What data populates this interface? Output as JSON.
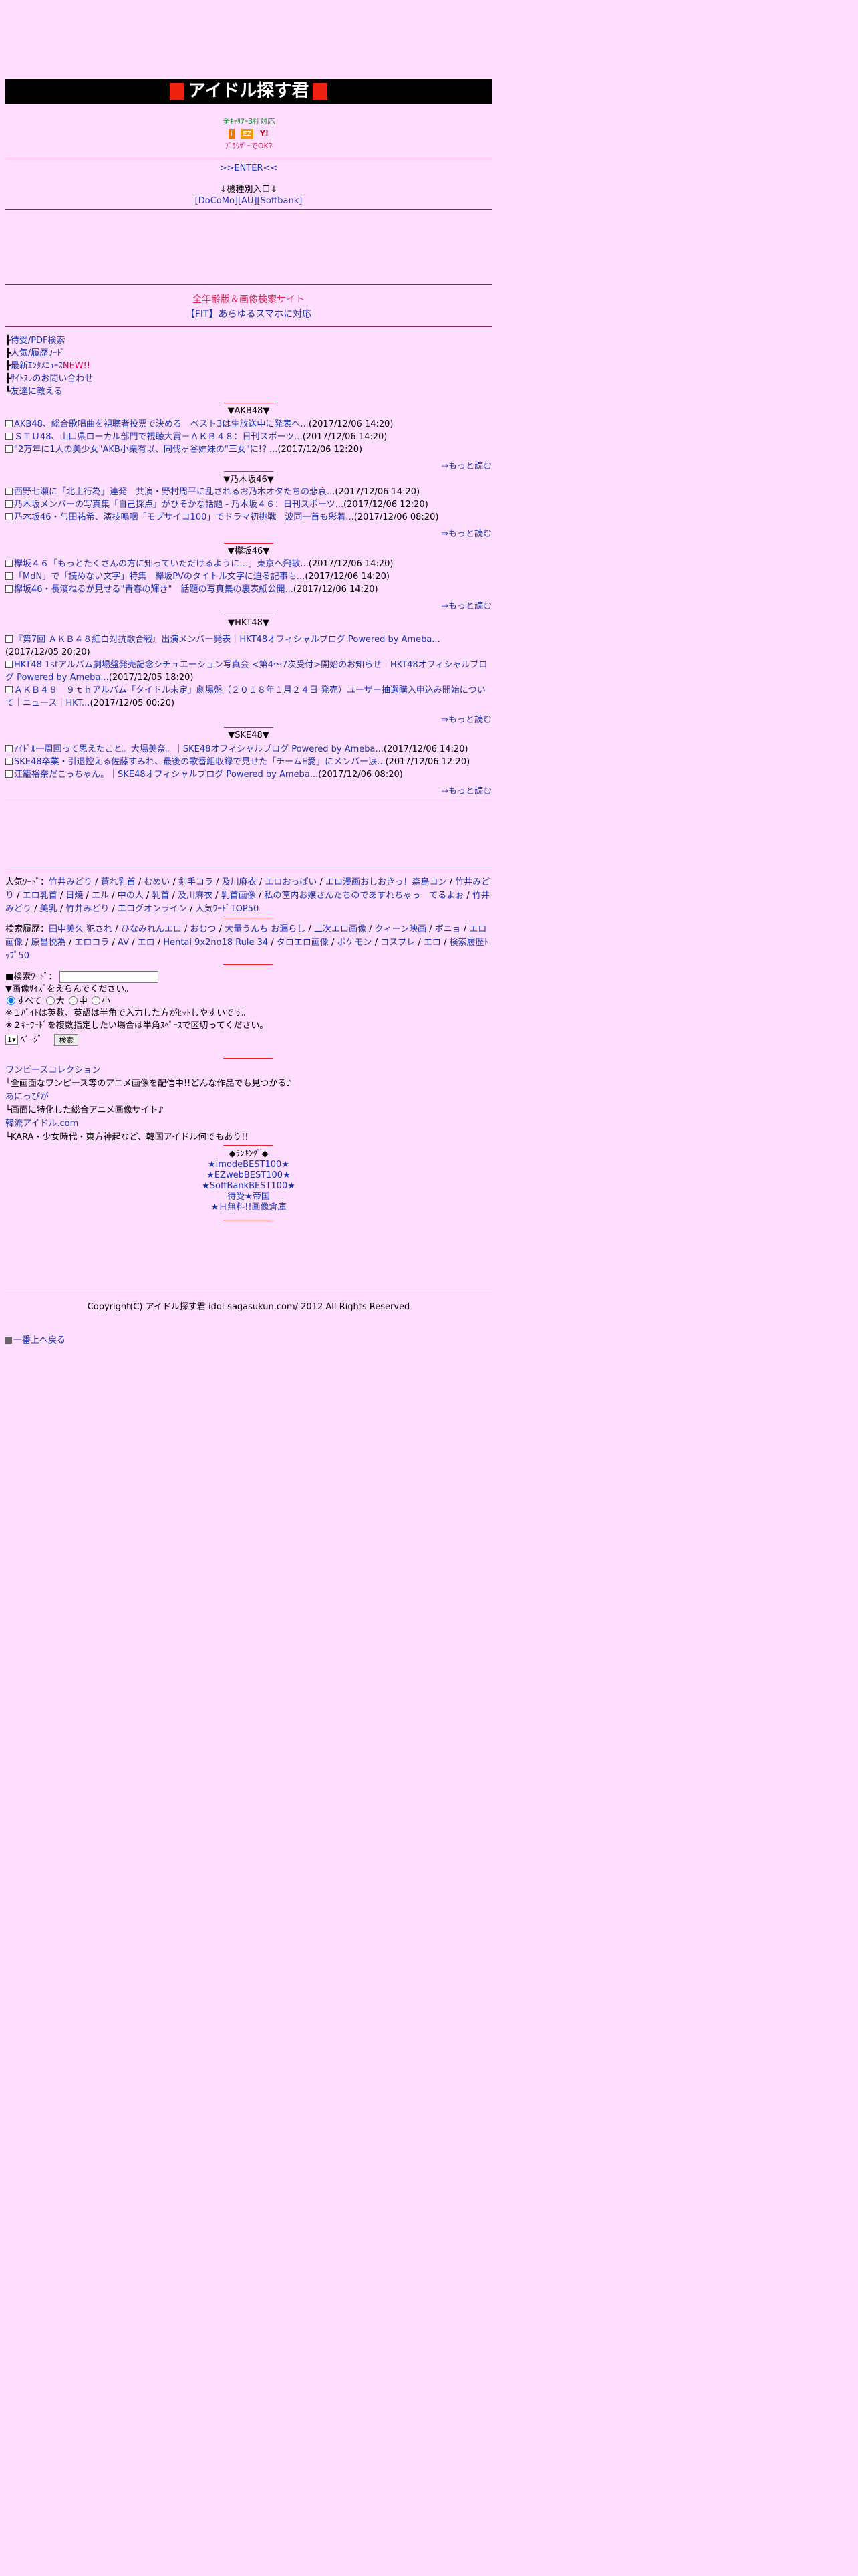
{
  "header": {
    "title": "アイドル探す君",
    "gem_color": "#ee1100",
    "bg": "#000000"
  },
  "intro": {
    "carrier_line": "全ｷｬﾘｱｰ3社対応",
    "carrier_icons": [
      "i",
      "EZ",
      "Y!"
    ],
    "pc_line": "ﾌﾞﾗｳｻﾞｰでOK?"
  },
  "enter_link": ">>ENTER<<",
  "models": {
    "label": "↓機種別入口↓",
    "links": [
      "[DoCoMo]",
      "[AU]",
      "[Softbank]"
    ]
  },
  "promo": {
    "line1": "全年齢版＆画像検索サイト",
    "line2": "【FIT】あらゆるスマホに対応"
  },
  "menu": [
    {
      "label": "待受/PDF検索"
    },
    {
      "label": "人気/履歴ﾜｰﾄﾞ"
    },
    {
      "label": "最新ｴﾝﾀﾒﾆｭｰｽ",
      "badge": "NEW!!"
    },
    {
      "label": "ｻｲﾄｽﾚのお問い合わせ"
    },
    {
      "label": "友達に教える"
    }
  ],
  "sections": [
    {
      "title": "▼AKB48▼",
      "items": [
        {
          "link": "AKB48、総合歌唱曲を視聴者投票で決める　ベスト3は生放送中に発表へ...",
          "date": "(2017/12/06 14:20)"
        },
        {
          "link": "ＳＴＵ48、山口県ローカル部門で視聴大賞－ＡＫＢ４８：日刊スポーツ...",
          "date": "(2017/12/06 14:20)"
        },
        {
          "link": "\"2万年に1人の美少女\"AKB小栗有以、同伐ヶ谷姉妹の\"三女\"に!? ...",
          "date": "(2017/12/06 12:20)"
        }
      ],
      "more": "⇒もっと読む"
    },
    {
      "title": "▼乃木坂46▼",
      "items": [
        {
          "link": "西野七瀬に「北上行為」連発　共演・野村周平に乱されるお乃木オタたちの悲哀...",
          "date": "(2017/12/06 14:20)"
        },
        {
          "link": "乃木坂メンバーの写真集「自己採点」がひそかな話題 - 乃木坂４６：日刊スポーツ...",
          "date": "(2017/12/06 12:20)"
        },
        {
          "link": "乃木坂46・与田祐希、演技嗚咽「モブサイコ100」でドラマ初挑戦　波同一首も彩着...",
          "date": "(2017/12/06 08:20)"
        }
      ],
      "more": "⇒もっと読む"
    },
    {
      "title": "▼欅坂46▼",
      "items": [
        {
          "link": "欅坂４６「もっとたくさんの方に知っていただけるように…」東京へ飛散...",
          "date": "(2017/12/06 14:20)"
        },
        {
          "link": "「MdN」で「読めない文字」特集　欅坂PVのタイトル文字に迫る記事も...",
          "date": "(2017/12/06 14:20)"
        },
        {
          "link": "欅坂46・長濱ねるが見せる\"青春の輝き\"　話題の写真集の裏表紙公開...",
          "date": "(2017/12/06 14:20)"
        }
      ],
      "more": "⇒もっと読む"
    },
    {
      "title": "▼HKT48▼",
      "items": [
        {
          "link": "『第7回 ＡＫＢ４８紅白対抗歌合戦』出演メンバー発表｜HKT48オフィシャルブログ Powered by Ameba...",
          "date": "(2017/12/05 20:20)"
        },
        {
          "link": "HKT48 1stアルバム劇場盤発売記念シチュエーション写真会 <第4〜7次受付>開始のお知らせ｜HKT48オフィシャルブログ Powered by Ameba...",
          "date": "(2017/12/05 18:20)"
        },
        {
          "link": "ＡＫＢ４８　９ｔｈアルバム「タイトル未定」劇場盤（２０１８年１月２４日 発売）ユーザー抽選購入申込み開始について｜ニュース｜HKT...",
          "date": "(2017/12/05 00:20)"
        }
      ],
      "more": "⇒もっと読む"
    },
    {
      "title": "▼SKE48▼",
      "items": [
        {
          "link": "ｱｲﾄﾞﾙ一周回って思えたこと。大場美奈。｜SKE48オフィシャルブログ Powered by Ameba...",
          "date": "(2017/12/06 14:20)"
        },
        {
          "link": "SKE48卒業・引退控える佐藤すみれ、最後の歌番組収録で見せた「チームE愛」にメンバー涙...",
          "date": "(2017/12/06 12:20)"
        },
        {
          "link": "江籠裕奈だこっちゃん。｜SKE48オフィシャルブログ Powered by Ameba...",
          "date": "(2017/12/06 08:20)"
        }
      ],
      "more": "⇒もっと読む"
    }
  ],
  "popular": {
    "label": "人気ﾜｰﾄﾞ：",
    "words": [
      "竹井みどり",
      "蒼れ乳首",
      "むめい",
      "剣手コラ",
      "及川麻衣",
      "エロおっぱい",
      "エロ漫画おしおきっ！森島コン",
      "竹井みどり",
      "エロ乳首",
      "日焼",
      "エル",
      "中の人",
      "乳首",
      "及川麻衣",
      "乳首画像",
      "私の筐内お嬢さんたちのであすれちゃっ　てるよぉ",
      "竹井みどり",
      "美乳",
      "竹井みどり",
      "エログオンライン"
    ],
    "top": "人気ﾜｰﾄﾞTOP50"
  },
  "history": {
    "label": "検索履歴：",
    "words": [
      "田中美久 犯され",
      "ひなみれんエロ",
      "おむつ",
      "大量うんち お漏らし",
      "二次エロ画像",
      "クィーン映画",
      "ボニョ",
      "エロ画像",
      "原昌悦為",
      "エロコラ",
      "AV",
      "エロ",
      "Hentai 9x2no18 Rule 34",
      "タロエロ画像",
      "ポケモン",
      "コスプレ",
      "エロ"
    ],
    "more": "検索履歴ﾄｯﾌﾟ50"
  },
  "search": {
    "label": "■検索ﾜｰﾄﾞ：",
    "value": "",
    "size_label": "▼画像ｻｲｽﾞをえらんでください。",
    "options": [
      "すべて",
      "大",
      "中",
      "小"
    ],
    "note1": "※１ﾊﾞｲﾄは英数、英語は半角で入力した方がﾋｯﾄしやすいです。",
    "note2": "※２ｷｰﾜｰﾄﾞを複数指定したい場合は半角ｽﾍﾟｰｽで区切ってください。",
    "page_select": "1",
    "page_label": "ﾍﾟｰｼﾞ",
    "button": "検索"
  },
  "feature": {
    "title": "ワンピースコレクション",
    "line1": "└全画面なワンピース等のアニメ画像を配信中!!どんな作品でも見つかる♪",
    "link1": "あにっぴが",
    "line2": "└画面に特化した総合アニメ画像サイト♪",
    "link2": "韓流アイドル.com",
    "line3": "└KARA・少女時代・東方神起など、韓国アイドル何でもあり!!"
  },
  "ranking": {
    "title": "◆ﾗﾝｷﾝｸﾞ◆",
    "links": [
      "★imodeBEST100★",
      "★EZwebBEST100★",
      "★SoftBankBEST100★",
      "待受★帝国",
      "★Ｈ無料!!画像倉庫"
    ]
  },
  "footer": {
    "copyright": "Copyright(C) アイドル探す君 idol-sagasukun.com/ 2012 All Rights Reserved",
    "top_link": "一番上へ戻る"
  }
}
